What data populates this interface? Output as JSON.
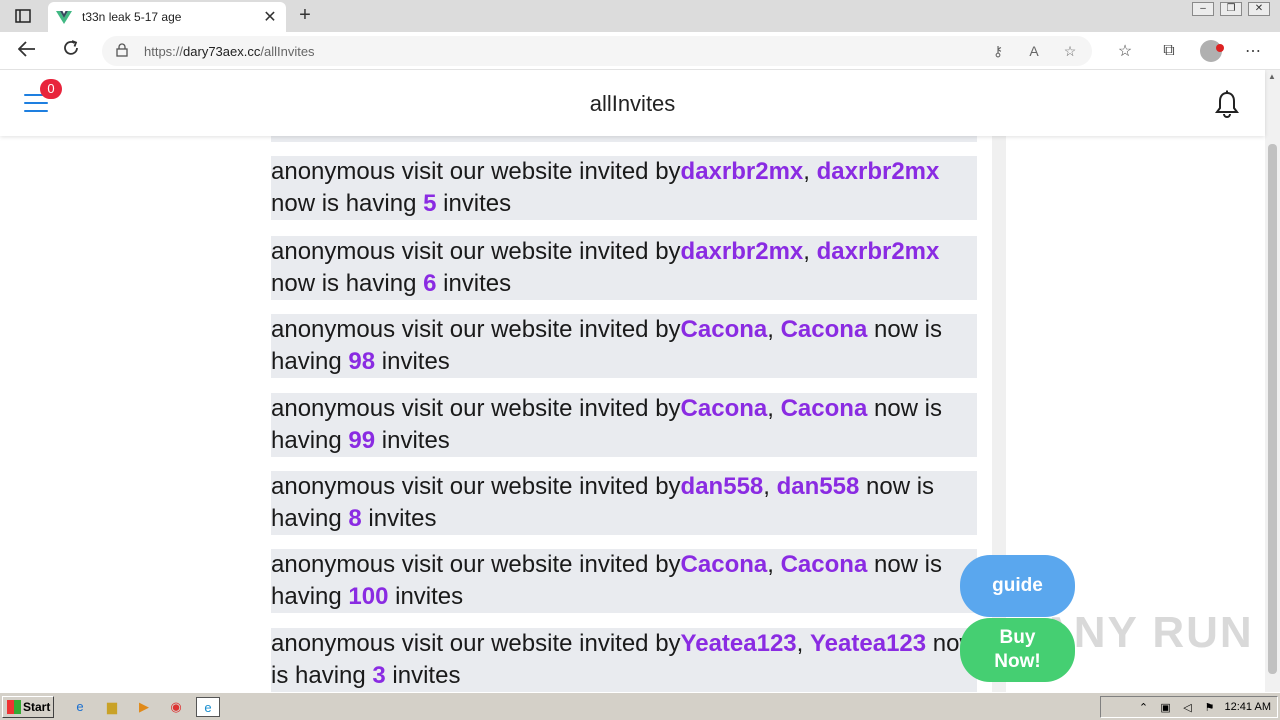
{
  "browser": {
    "tab_title": "t33n leak 5-17 age",
    "tab_close": "✕",
    "new_tab": "+",
    "url_scheme": "https://",
    "url_host": "dary73aex.cc",
    "url_path": "/allInvites"
  },
  "app": {
    "title": "allInvites",
    "notification_count": "0"
  },
  "entries": [
    {
      "prefix": "anonymous visit our website invited by",
      "inviter": "daxrbr2mx",
      "user": "daxrbr2mx",
      "mid": " now is having ",
      "count": "5",
      "suffix": " invites"
    },
    {
      "prefix": "anonymous visit our website invited by",
      "inviter": "daxrbr2mx",
      "user": "daxrbr2mx",
      "mid": " now is having ",
      "count": "6",
      "suffix": " invites"
    },
    {
      "prefix": "anonymous visit our website invited by",
      "inviter": "Cacona",
      "user": "Cacona",
      "mid": " now is having ",
      "count": "98",
      "suffix": " invites"
    },
    {
      "prefix": "anonymous visit our website invited by",
      "inviter": "Cacona",
      "user": "Cacona",
      "mid": " now is having ",
      "count": "99",
      "suffix": " invites"
    },
    {
      "prefix": "anonymous visit our website invited by",
      "inviter": "dan558",
      "user": "dan558",
      "mid": " now is having ",
      "count": "8",
      "suffix": " invites"
    },
    {
      "prefix": "anonymous visit our website invited by",
      "inviter": "Cacona",
      "user": "Cacona",
      "mid": " now is having ",
      "count": "100",
      "suffix": " invites"
    },
    {
      "prefix": "anonymous visit our website invited by",
      "inviter": "Yeatea123",
      "user": "Yeatea123",
      "mid": " now is having ",
      "count": "3",
      "suffix": " invites"
    }
  ],
  "buttons": {
    "guide": "guide",
    "buy_now_line1": "Buy",
    "buy_now_line2": "Now!"
  },
  "watermark": "ANY RUN",
  "taskbar": {
    "start": "Start",
    "clock": "12:41 AM"
  },
  "colors": {
    "accent_purple": "#8a2be2",
    "guide_blue": "#5aa7ee",
    "buy_green": "#45cf72",
    "badge_red": "#e8243c",
    "menu_blue": "#1e7fe0"
  }
}
